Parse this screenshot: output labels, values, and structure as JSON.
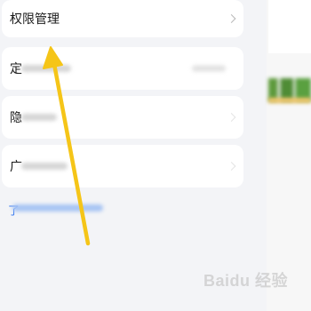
{
  "settings": {
    "permission_label": "权限管理",
    "row1_label": "定",
    "row2_label": "隐",
    "row3_label": "广"
  },
  "link_first_char": "了",
  "watermark": "Baidu 经验",
  "colors": {
    "arrow": "#f5c518",
    "card": "#ffffff",
    "background": "#f3f4f7",
    "link": "#3a7bf0"
  },
  "icons": [
    "chevron-right-icon",
    "annotation-arrow-icon"
  ]
}
